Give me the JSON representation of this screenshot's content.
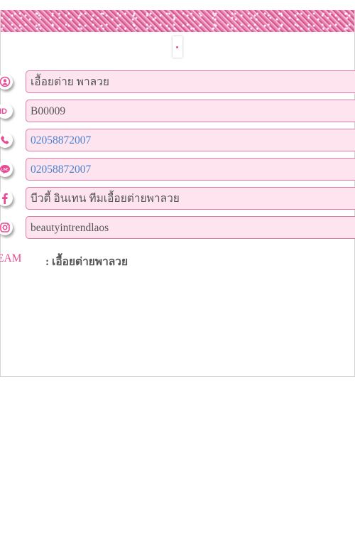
{
  "profile": {
    "name": "เอื้อยต่าย  พาลวย",
    "id": "B00009",
    "phone": "02058872007",
    "line": "02058872007",
    "facebook": "บีวตี้ อินเทน ทีมเอื้อยต่ายพาลวย",
    "instagram": "beautyintrendlaos"
  },
  "team": {
    "label": "EAM",
    "value": ": เอื้อยต่ายพาลวย"
  },
  "icons": {
    "name": "user-icon",
    "id": "id-icon",
    "phone": "phone-icon",
    "line": "line-chat-icon",
    "facebook": "facebook-icon",
    "instagram": "instagram-icon"
  },
  "colors": {
    "accent": "#e64b95",
    "field_bg": "#fde4ef",
    "field_border": "#e07aa6",
    "link": "#4a83d1"
  }
}
